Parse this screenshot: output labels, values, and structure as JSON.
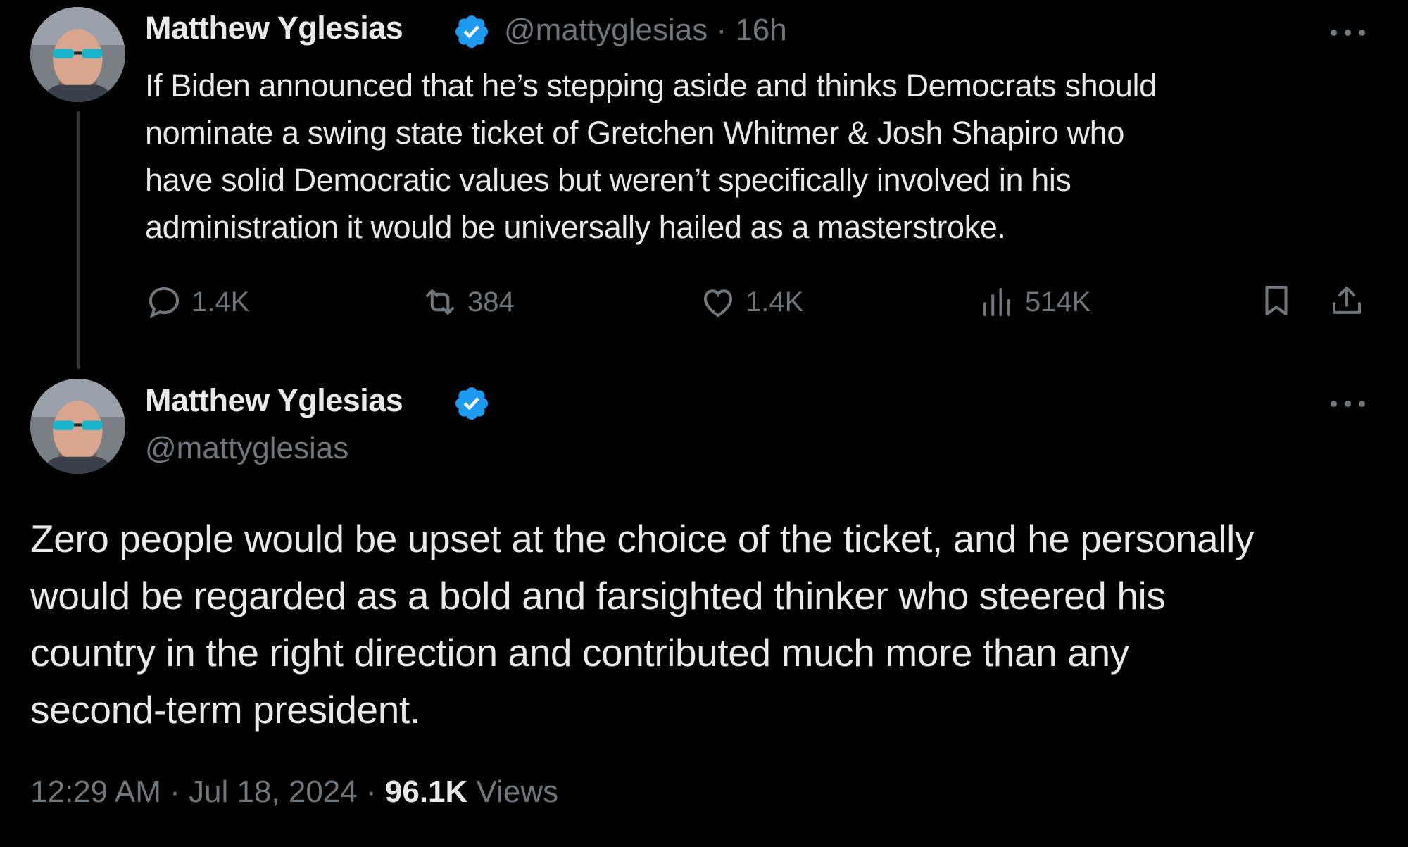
{
  "tweet1": {
    "author_name": "Matthew Yglesias",
    "handle": "@mattyglesias",
    "time": "· 16h",
    "text": "If Biden announced that he’s stepping aside and thinks Democrats should\nnominate a swing state ticket of Gretchen Whitmer & Josh Shapiro who\nhave solid Democratic values but weren’t specifically involved in his\nadministration it would be universally hailed as a masterstroke.",
    "replies": "1.4K",
    "reposts": "384",
    "likes": "1.4K",
    "views": "514K"
  },
  "tweet2": {
    "author_name": "Matthew Yglesias",
    "handle": "@mattyglesias",
    "text": "Zero people would be upset at the choice of the ticket, and he personally\nwould be regarded as a bold and farsighted thinker who steered his\ncountry in the right direction and contributed much more than any\nsecond-term president.",
    "timestamp": "12:29 AM · Jul 18, 2024 ·",
    "views_count": "96.1K",
    "views_label": "Views"
  },
  "icons": {
    "verified": "verified-badge-icon",
    "reply": "reply-icon",
    "repost": "repost-icon",
    "like": "like-icon",
    "views": "views-icon",
    "bookmark": "bookmark-icon",
    "share": "share-icon",
    "more": "more-icon"
  },
  "colors": {
    "background": "#000000",
    "text": "#e7e9ea",
    "muted": "#71767b",
    "verified": "#1d9bf0"
  }
}
